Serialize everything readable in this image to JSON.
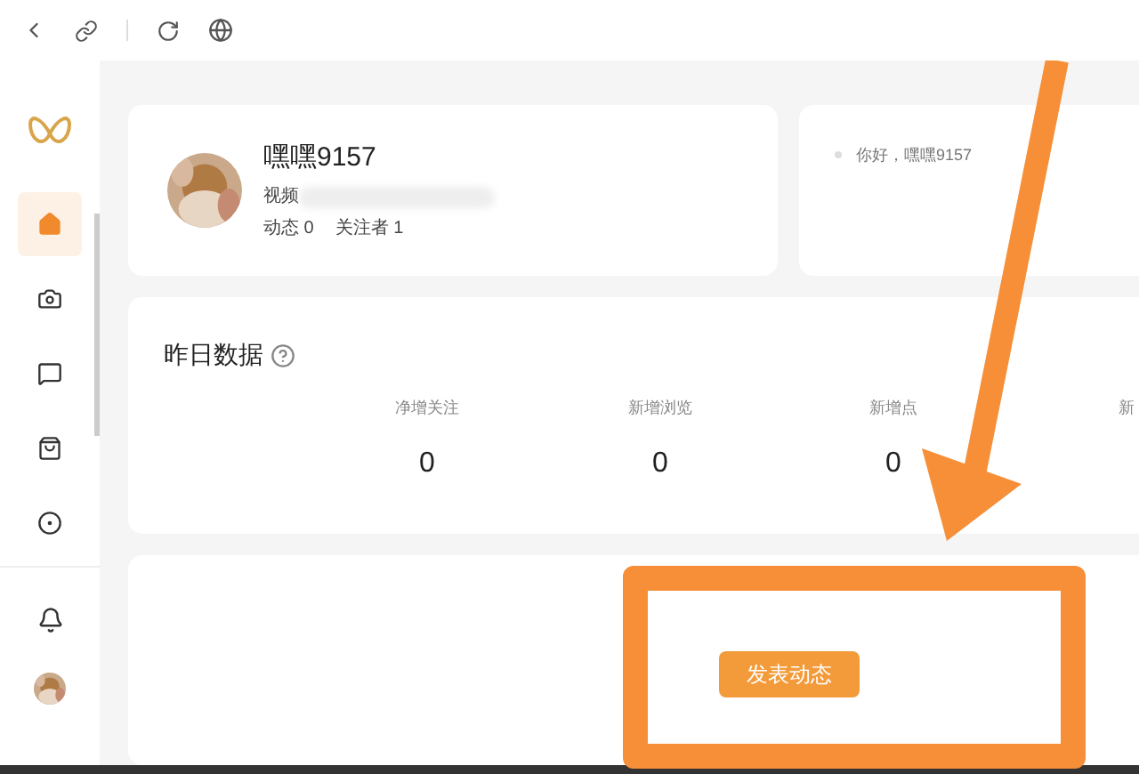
{
  "sidebar": {
    "items": [
      {
        "kind": "home",
        "selected": true
      },
      {
        "kind": "camera",
        "selected": false
      },
      {
        "kind": "message",
        "selected": false
      },
      {
        "kind": "bag",
        "selected": false
      },
      {
        "kind": "target",
        "selected": false
      }
    ]
  },
  "profile": {
    "name": "嘿嘿9157",
    "id_label": "视频",
    "stats": [
      {
        "label": "动态",
        "value": "0"
      },
      {
        "label": "关注者",
        "value": "1"
      }
    ]
  },
  "greeting": {
    "text": "你好，嘿嘿9157"
  },
  "yesterday": {
    "title": "昨日数据",
    "metrics": [
      {
        "label": "净增关注",
        "value": "0"
      },
      {
        "label": "新增浏览",
        "value": "0"
      },
      {
        "label": "新增点",
        "value": "0"
      },
      {
        "label": "新"
      }
    ]
  },
  "publish_button": {
    "label": "发表动态"
  }
}
